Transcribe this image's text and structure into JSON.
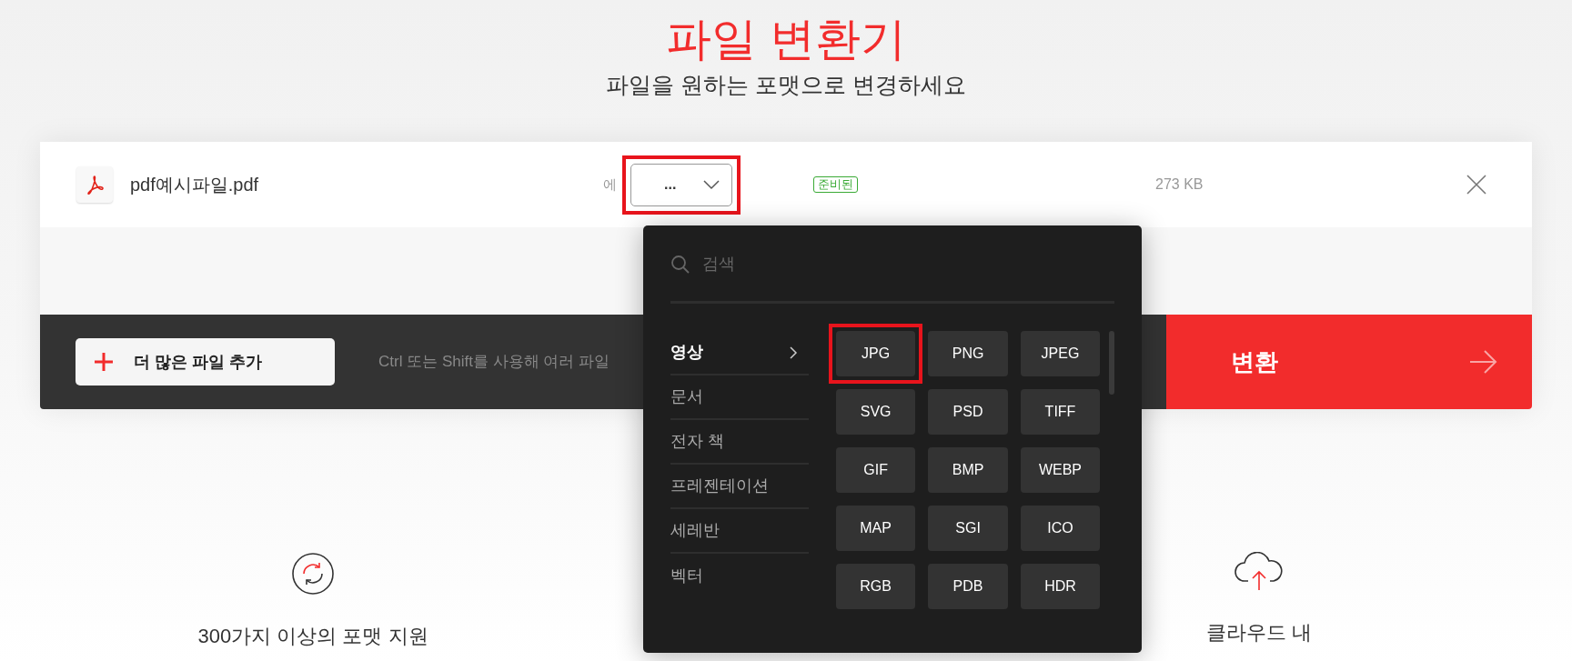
{
  "header": {
    "title": "파일 변환기",
    "subtitle": "파일을 원하는 포맷으로 변경하세요"
  },
  "file": {
    "name": "pdf예시파일.pdf",
    "to_label": "에",
    "target": {
      "value": "...",
      "highlighted": true
    },
    "status": "준비된",
    "size": "273 KB"
  },
  "toolbar": {
    "add_button": "더 많은 파일 추가",
    "hint": "Ctrl 또는 Shift를 사용해 여러 파일",
    "convert_button": "변환"
  },
  "dropdown": {
    "search_placeholder": "검색",
    "categories": [
      {
        "label": "영상",
        "selected": true
      },
      {
        "label": "문서",
        "selected": false
      },
      {
        "label": "전자 책",
        "selected": false
      },
      {
        "label": "프레젠테이션",
        "selected": false
      },
      {
        "label": "세레반",
        "selected": false
      },
      {
        "label": "벡터",
        "selected": false
      }
    ],
    "formats": [
      {
        "label": "JPG",
        "highlighted": true
      },
      {
        "label": "PNG",
        "highlighted": false
      },
      {
        "label": "JPEG",
        "highlighted": false
      },
      {
        "label": "SVG",
        "highlighted": false
      },
      {
        "label": "PSD",
        "highlighted": false
      },
      {
        "label": "TIFF",
        "highlighted": false
      },
      {
        "label": "GIF",
        "highlighted": false
      },
      {
        "label": "BMP",
        "highlighted": false
      },
      {
        "label": "WEBP",
        "highlighted": false
      },
      {
        "label": "MAP",
        "highlighted": false
      },
      {
        "label": "SGI",
        "highlighted": false
      },
      {
        "label": "ICO",
        "highlighted": false
      },
      {
        "label": "RGB",
        "highlighted": false
      },
      {
        "label": "PDB",
        "highlighted": false
      },
      {
        "label": "HDR",
        "highlighted": false
      }
    ]
  },
  "features": [
    {
      "kind": "refresh",
      "text": "300가지 이상의 포맷 지원"
    },
    {
      "kind": "cloud",
      "text": "클라우드 내"
    }
  ]
}
